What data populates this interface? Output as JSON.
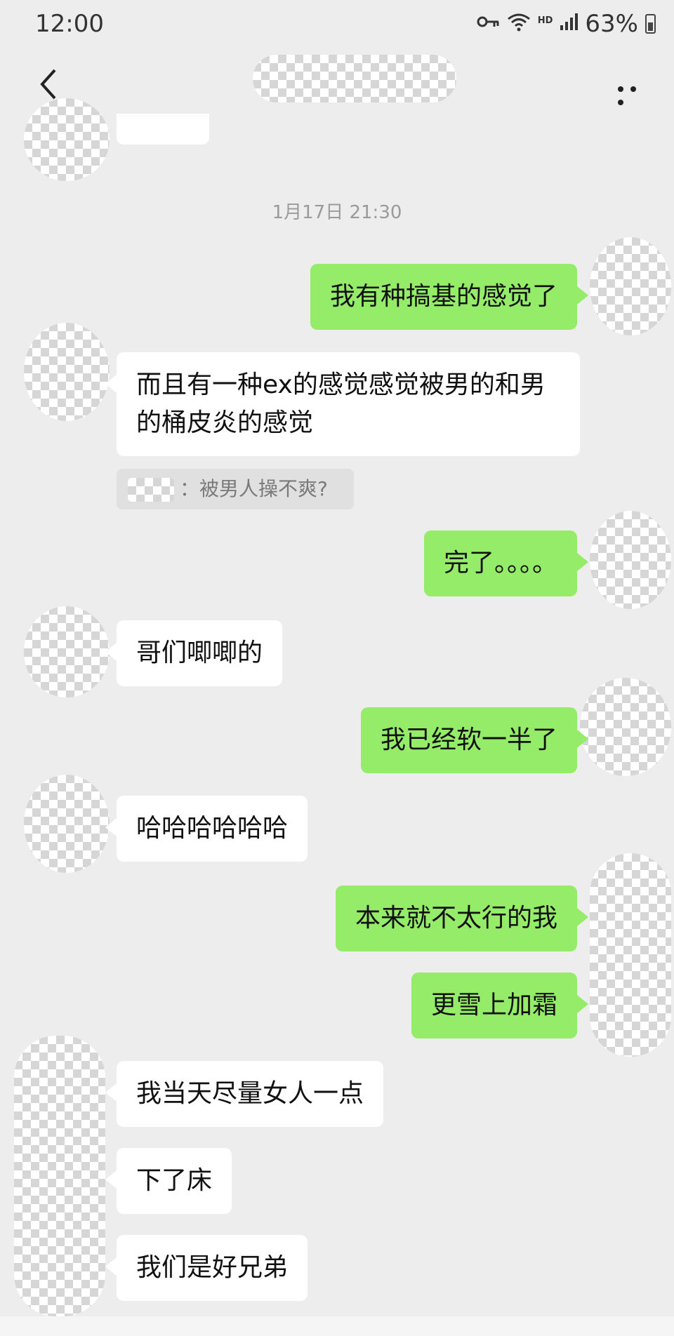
{
  "status": {
    "time": "12:00",
    "hd": "HD",
    "battery": "63%"
  },
  "header": {
    "back": "‹",
    "more": "..."
  },
  "timestamp": "1月17日 21:30",
  "messages": [
    {
      "side": "right",
      "text": "我有种搞基的感觉了"
    },
    {
      "side": "left",
      "text": "而且有一种ex的感觉感觉被男的和男的桶皮炎的感觉"
    },
    {
      "side": "right",
      "text": "完了。。。。"
    },
    {
      "side": "left",
      "text": "哥们唧唧的"
    },
    {
      "side": "right",
      "text": "我已经软一半了"
    },
    {
      "side": "left",
      "text": "哈哈哈哈哈哈"
    },
    {
      "side": "right",
      "text": "本来就不太行的我"
    },
    {
      "side": "right",
      "text": "更雪上加霜"
    },
    {
      "side": "left",
      "text": "我当天尽量女人一点"
    },
    {
      "side": "left",
      "text": "下了床"
    },
    {
      "side": "left",
      "text": "我们是好兄弟"
    }
  ],
  "quote": {
    "text": "：被男人操不爽?"
  }
}
